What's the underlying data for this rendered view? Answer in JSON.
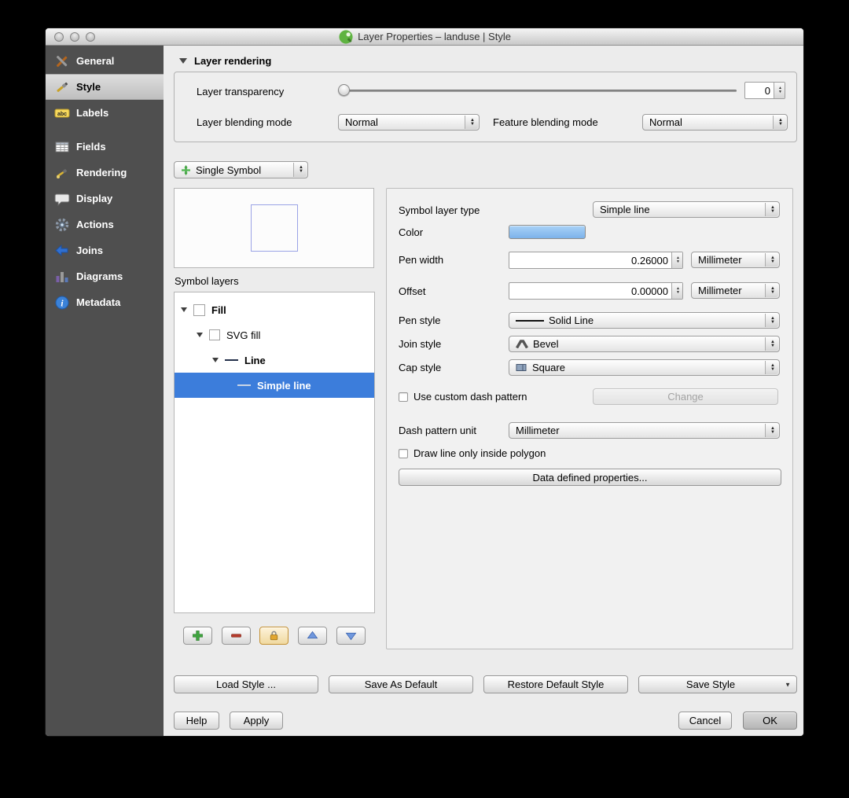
{
  "window": {
    "title": "Layer Properties – landuse | Style"
  },
  "sidebar": {
    "items": [
      {
        "label": "General",
        "icon": "general-icon"
      },
      {
        "label": "Style",
        "icon": "style-icon",
        "selected": true
      },
      {
        "label": "Labels",
        "icon": "labels-icon"
      },
      {
        "label": "Fields",
        "icon": "fields-icon"
      },
      {
        "label": "Rendering",
        "icon": "rendering-icon"
      },
      {
        "label": "Display",
        "icon": "display-icon"
      },
      {
        "label": "Actions",
        "icon": "actions-icon"
      },
      {
        "label": "Joins",
        "icon": "joins-icon"
      },
      {
        "label": "Diagrams",
        "icon": "diagrams-icon"
      },
      {
        "label": "Metadata",
        "icon": "metadata-icon"
      }
    ],
    "labels_icon_text": "abc",
    "metadata_icon_text": "i"
  },
  "layer_rendering": {
    "section_label": "Layer rendering",
    "transparency_label": "Layer transparency",
    "transparency_value": "0",
    "blending_label": "Layer blending mode",
    "blending_value": "Normal",
    "feature_blending_label": "Feature blending mode",
    "feature_blending_value": "Normal"
  },
  "renderer": {
    "value": "Single Symbol"
  },
  "symbol_layers": {
    "label": "Symbol layers",
    "tree": [
      {
        "label": "Fill",
        "bold": true,
        "selected": false
      },
      {
        "label": "SVG fill",
        "bold": false,
        "selected": false
      },
      {
        "label": "Line",
        "bold": true,
        "selected": false
      },
      {
        "label": "Simple line",
        "bold": false,
        "selected": true
      }
    ]
  },
  "properties": {
    "symbol_layer_type_label": "Symbol layer type",
    "symbol_layer_type_value": "Simple line",
    "color_label": "Color",
    "pen_width_label": "Pen width",
    "pen_width_value": "0.26000",
    "pen_width_unit": "Millimeter",
    "offset_label": "Offset",
    "offset_value": "0.00000",
    "offset_unit": "Millimeter",
    "pen_style_label": "Pen style",
    "pen_style_value": "Solid Line",
    "join_style_label": "Join style",
    "join_style_value": "Bevel",
    "cap_style_label": "Cap style",
    "cap_style_value": "Square",
    "dash_checkbox_label": "Use custom dash pattern",
    "change_button": "Change",
    "dash_unit_label": "Dash pattern unit",
    "dash_unit_value": "Millimeter",
    "draw_inside_label": "Draw line only inside polygon",
    "data_defined_button": "Data defined properties..."
  },
  "footer": {
    "load_style": "Load Style ...",
    "save_as_default": "Save As Default",
    "restore_default": "Restore Default Style",
    "save_style": "Save Style",
    "help": "Help",
    "apply": "Apply",
    "cancel": "Cancel",
    "ok": "OK"
  },
  "colors": {
    "selection_blue": "#3c7ddb",
    "symbol_color_swatch": "#7cb2ea",
    "preview_outline": "#9aa3e6",
    "sidebar_bg": "#4f4f4f"
  }
}
